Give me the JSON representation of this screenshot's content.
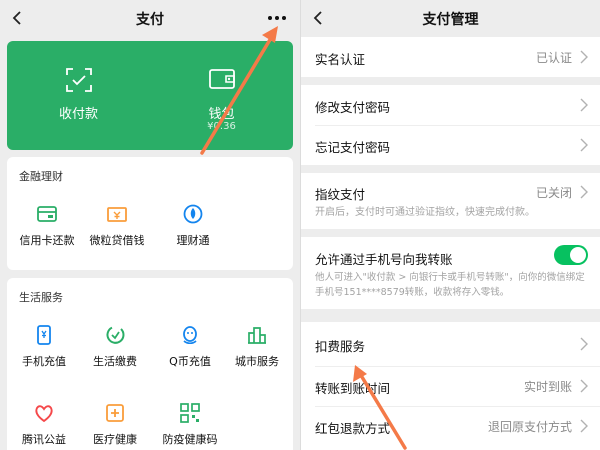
{
  "left_screen": {
    "title": "支付",
    "green_card": {
      "collect_label": "收付款",
      "wallet_label": "钱包",
      "wallet_balance": "¥0.36"
    },
    "finance": {
      "title": "金融理财",
      "items": [
        {
          "label": "信用卡还款",
          "icon": "credit-card-icon"
        },
        {
          "label": "微粒贷借钱",
          "icon": "loan-icon"
        },
        {
          "label": "理财通",
          "icon": "wealth-icon"
        }
      ]
    },
    "life": {
      "title": "生活服务",
      "items": [
        {
          "label": "手机充值",
          "icon": "phone-recharge-icon"
        },
        {
          "label": "生活缴费",
          "icon": "utility-payment-icon"
        },
        {
          "label": "Q币充值",
          "icon": "qq-coin-icon"
        },
        {
          "label": "城市服务",
          "icon": "city-service-icon"
        },
        {
          "label": "腾讯公益",
          "icon": "charity-icon"
        },
        {
          "label": "医疗健康",
          "icon": "medical-icon"
        },
        {
          "label": "防疫健康码",
          "icon": "health-code-icon"
        }
      ]
    }
  },
  "right_screen": {
    "title": "支付管理",
    "verification": {
      "label": "实名认证",
      "value": "已认证"
    },
    "change_password": {
      "label": "修改支付密码"
    },
    "forgot_password": {
      "label": "忘记支付密码"
    },
    "fingerprint": {
      "label": "指纹支付",
      "value": "已关闭",
      "desc": "开启后，支付时可通过验证指纹，快速完成付款。"
    },
    "phone_transfer": {
      "label": "允许通过手机号向我转账",
      "enabled": true,
      "desc": "他人可进入\"收付款 > 向银行卡或手机号转账\"，向你的微信绑定手机号151****8579转账，收款将存入零钱。"
    },
    "deduction": {
      "label": "扣费服务"
    },
    "arrival_time": {
      "label": "转账到账时间",
      "value": "实时到账"
    },
    "red_packet_refund": {
      "label": "红包退款方式",
      "value": "退回原支付方式"
    }
  },
  "colors": {
    "wechat_green": "#2aae67",
    "toggle_green": "#07c160",
    "arrow_orange": "#f47a48",
    "icon_blue": "#1485ee",
    "icon_orange": "#fa9d3b",
    "icon_red": "#f5484a"
  }
}
